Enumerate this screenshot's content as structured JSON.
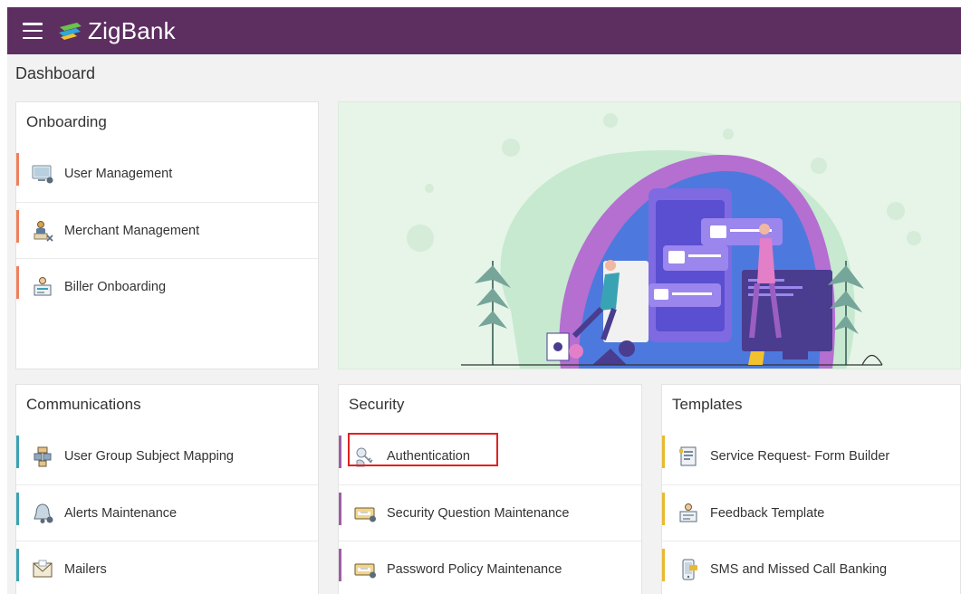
{
  "app": {
    "brand": "ZigBank"
  },
  "page": {
    "title": "Dashboard"
  },
  "colors": {
    "header": "#5d2f61",
    "onboarding_accent": "#f07f5c",
    "communications_accent": "#3aa3b3",
    "security_accent": "#9d5fa4",
    "templates_accent": "#e9b930",
    "highlight": "#e0221f"
  },
  "onboarding": {
    "title": "Onboarding",
    "items": [
      {
        "label": "User Management",
        "icon": "computer-user-icon"
      },
      {
        "label": "Merchant Management",
        "icon": "merchant-icon"
      },
      {
        "label": "Biller Onboarding",
        "icon": "biller-icon"
      }
    ]
  },
  "communications": {
    "title": "Communications",
    "items": [
      {
        "label": "User Group Subject Mapping",
        "icon": "group-mapping-icon"
      },
      {
        "label": "Alerts Maintenance",
        "icon": "bell-icon"
      },
      {
        "label": "Mailers",
        "icon": "mail-icon"
      }
    ]
  },
  "security": {
    "title": "Security",
    "items": [
      {
        "label": "Authentication",
        "icon": "key-hand-icon",
        "highlighted": true
      },
      {
        "label": "Security Question Maintenance",
        "icon": "password-card-icon"
      },
      {
        "label": "Password Policy Maintenance",
        "icon": "password-card-icon"
      }
    ]
  },
  "templates": {
    "title": "Templates",
    "items": [
      {
        "label": "Service Request- Form Builder",
        "icon": "form-builder-icon"
      },
      {
        "label": "Feedback Template",
        "icon": "feedback-icon"
      },
      {
        "label": "SMS and Missed Call Banking",
        "icon": "sms-phone-icon"
      }
    ]
  },
  "banner": {
    "illustration": "mobile-app-team-illustration"
  }
}
